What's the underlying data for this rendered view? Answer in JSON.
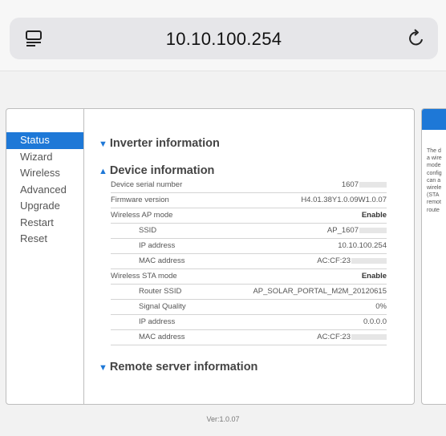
{
  "browser": {
    "url": "10.10.100.254",
    "icons": {
      "reader": "reader-mode-icon",
      "reload": "reload-icon"
    }
  },
  "nav": {
    "items": [
      {
        "label": "Status",
        "active": true
      },
      {
        "label": "Wizard",
        "active": false
      },
      {
        "label": "Wireless",
        "active": false
      },
      {
        "label": "Advanced",
        "active": false
      },
      {
        "label": "Upgrade",
        "active": false
      },
      {
        "label": "Restart",
        "active": false
      },
      {
        "label": "Reset",
        "active": false
      }
    ]
  },
  "sections": {
    "inverter": "Inverter information",
    "device": "Device information",
    "remote": "Remote server information"
  },
  "device_info": {
    "serial_label": "Device serial number",
    "serial_value": "1607",
    "firmware_label": "Firmware version",
    "firmware_value": "H4.01.38Y1.0.09W1.0.07",
    "ap_mode_label": "Wireless AP mode",
    "ap_mode_value": "Enable",
    "ap_ssid_label": "SSID",
    "ap_ssid_value": "AP_1607",
    "ap_ip_label": "IP address",
    "ap_ip_value": "10.10.100.254",
    "ap_mac_label": "MAC address",
    "ap_mac_value": "AC:CF:23",
    "sta_mode_label": "Wireless STA mode",
    "sta_mode_value": "Enable",
    "router_ssid_label": "Router SSID",
    "router_ssid_value": "AP_SOLAR_PORTAL_M2M_20120615",
    "signal_label": "Signal Quality",
    "signal_value": "0%",
    "sta_ip_label": "IP address",
    "sta_ip_value": "0.0.0.0",
    "sta_mac_label": "MAC address",
    "sta_mac_value": "AC:CF:23"
  },
  "side_panel": {
    "lines": [
      "The d",
      "a wire",
      "mode",
      "config",
      "can a",
      "wirele",
      "(STA",
      "remot",
      "route"
    ]
  },
  "footer": {
    "version": "Ver:1.0.07"
  },
  "colors": {
    "accent": "#1e78d7"
  }
}
